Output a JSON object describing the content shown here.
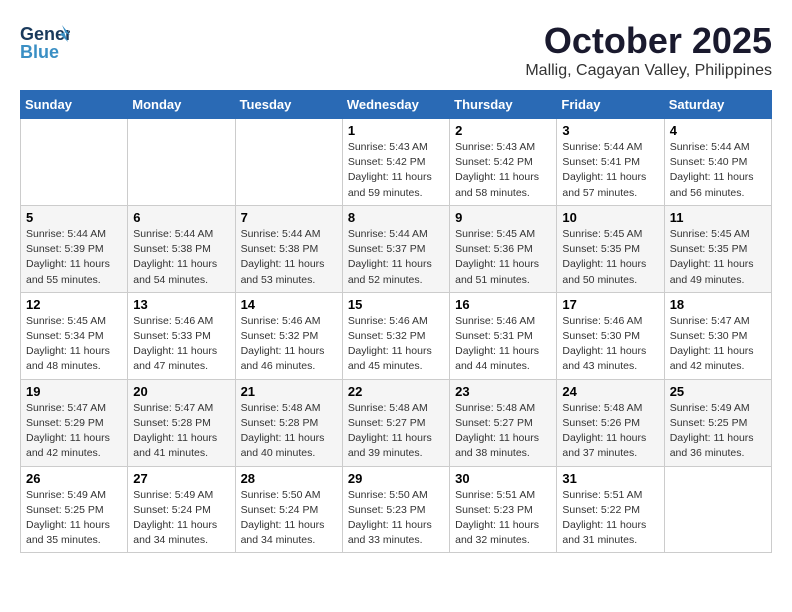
{
  "header": {
    "logo": {
      "general": "General",
      "blue": "Blue",
      "icon": "🔵"
    },
    "title": "October 2025",
    "subtitle": "Mallig, Cagayan Valley, Philippines"
  },
  "weekdays": [
    "Sunday",
    "Monday",
    "Tuesday",
    "Wednesday",
    "Thursday",
    "Friday",
    "Saturday"
  ],
  "weeks": [
    [
      {
        "day": "",
        "sunrise": "",
        "sunset": "",
        "daylight": ""
      },
      {
        "day": "",
        "sunrise": "",
        "sunset": "",
        "daylight": ""
      },
      {
        "day": "",
        "sunrise": "",
        "sunset": "",
        "daylight": ""
      },
      {
        "day": "1",
        "sunrise": "Sunrise: 5:43 AM",
        "sunset": "Sunset: 5:42 PM",
        "daylight": "Daylight: 11 hours and 59 minutes."
      },
      {
        "day": "2",
        "sunrise": "Sunrise: 5:43 AM",
        "sunset": "Sunset: 5:42 PM",
        "daylight": "Daylight: 11 hours and 58 minutes."
      },
      {
        "day": "3",
        "sunrise": "Sunrise: 5:44 AM",
        "sunset": "Sunset: 5:41 PM",
        "daylight": "Daylight: 11 hours and 57 minutes."
      },
      {
        "day": "4",
        "sunrise": "Sunrise: 5:44 AM",
        "sunset": "Sunset: 5:40 PM",
        "daylight": "Daylight: 11 hours and 56 minutes."
      }
    ],
    [
      {
        "day": "5",
        "sunrise": "Sunrise: 5:44 AM",
        "sunset": "Sunset: 5:39 PM",
        "daylight": "Daylight: 11 hours and 55 minutes."
      },
      {
        "day": "6",
        "sunrise": "Sunrise: 5:44 AM",
        "sunset": "Sunset: 5:38 PM",
        "daylight": "Daylight: 11 hours and 54 minutes."
      },
      {
        "day": "7",
        "sunrise": "Sunrise: 5:44 AM",
        "sunset": "Sunset: 5:38 PM",
        "daylight": "Daylight: 11 hours and 53 minutes."
      },
      {
        "day": "8",
        "sunrise": "Sunrise: 5:44 AM",
        "sunset": "Sunset: 5:37 PM",
        "daylight": "Daylight: 11 hours and 52 minutes."
      },
      {
        "day": "9",
        "sunrise": "Sunrise: 5:45 AM",
        "sunset": "Sunset: 5:36 PM",
        "daylight": "Daylight: 11 hours and 51 minutes."
      },
      {
        "day": "10",
        "sunrise": "Sunrise: 5:45 AM",
        "sunset": "Sunset: 5:35 PM",
        "daylight": "Daylight: 11 hours and 50 minutes."
      },
      {
        "day": "11",
        "sunrise": "Sunrise: 5:45 AM",
        "sunset": "Sunset: 5:35 PM",
        "daylight": "Daylight: 11 hours and 49 minutes."
      }
    ],
    [
      {
        "day": "12",
        "sunrise": "Sunrise: 5:45 AM",
        "sunset": "Sunset: 5:34 PM",
        "daylight": "Daylight: 11 hours and 48 minutes."
      },
      {
        "day": "13",
        "sunrise": "Sunrise: 5:46 AM",
        "sunset": "Sunset: 5:33 PM",
        "daylight": "Daylight: 11 hours and 47 minutes."
      },
      {
        "day": "14",
        "sunrise": "Sunrise: 5:46 AM",
        "sunset": "Sunset: 5:32 PM",
        "daylight": "Daylight: 11 hours and 46 minutes."
      },
      {
        "day": "15",
        "sunrise": "Sunrise: 5:46 AM",
        "sunset": "Sunset: 5:32 PM",
        "daylight": "Daylight: 11 hours and 45 minutes."
      },
      {
        "day": "16",
        "sunrise": "Sunrise: 5:46 AM",
        "sunset": "Sunset: 5:31 PM",
        "daylight": "Daylight: 11 hours and 44 minutes."
      },
      {
        "day": "17",
        "sunrise": "Sunrise: 5:46 AM",
        "sunset": "Sunset: 5:30 PM",
        "daylight": "Daylight: 11 hours and 43 minutes."
      },
      {
        "day": "18",
        "sunrise": "Sunrise: 5:47 AM",
        "sunset": "Sunset: 5:30 PM",
        "daylight": "Daylight: 11 hours and 42 minutes."
      }
    ],
    [
      {
        "day": "19",
        "sunrise": "Sunrise: 5:47 AM",
        "sunset": "Sunset: 5:29 PM",
        "daylight": "Daylight: 11 hours and 42 minutes."
      },
      {
        "day": "20",
        "sunrise": "Sunrise: 5:47 AM",
        "sunset": "Sunset: 5:28 PM",
        "daylight": "Daylight: 11 hours and 41 minutes."
      },
      {
        "day": "21",
        "sunrise": "Sunrise: 5:48 AM",
        "sunset": "Sunset: 5:28 PM",
        "daylight": "Daylight: 11 hours and 40 minutes."
      },
      {
        "day": "22",
        "sunrise": "Sunrise: 5:48 AM",
        "sunset": "Sunset: 5:27 PM",
        "daylight": "Daylight: 11 hours and 39 minutes."
      },
      {
        "day": "23",
        "sunrise": "Sunrise: 5:48 AM",
        "sunset": "Sunset: 5:27 PM",
        "daylight": "Daylight: 11 hours and 38 minutes."
      },
      {
        "day": "24",
        "sunrise": "Sunrise: 5:48 AM",
        "sunset": "Sunset: 5:26 PM",
        "daylight": "Daylight: 11 hours and 37 minutes."
      },
      {
        "day": "25",
        "sunrise": "Sunrise: 5:49 AM",
        "sunset": "Sunset: 5:25 PM",
        "daylight": "Daylight: 11 hours and 36 minutes."
      }
    ],
    [
      {
        "day": "26",
        "sunrise": "Sunrise: 5:49 AM",
        "sunset": "Sunset: 5:25 PM",
        "daylight": "Daylight: 11 hours and 35 minutes."
      },
      {
        "day": "27",
        "sunrise": "Sunrise: 5:49 AM",
        "sunset": "Sunset: 5:24 PM",
        "daylight": "Daylight: 11 hours and 34 minutes."
      },
      {
        "day": "28",
        "sunrise": "Sunrise: 5:50 AM",
        "sunset": "Sunset: 5:24 PM",
        "daylight": "Daylight: 11 hours and 34 minutes."
      },
      {
        "day": "29",
        "sunrise": "Sunrise: 5:50 AM",
        "sunset": "Sunset: 5:23 PM",
        "daylight": "Daylight: 11 hours and 33 minutes."
      },
      {
        "day": "30",
        "sunrise": "Sunrise: 5:51 AM",
        "sunset": "Sunset: 5:23 PM",
        "daylight": "Daylight: 11 hours and 32 minutes."
      },
      {
        "day": "31",
        "sunrise": "Sunrise: 5:51 AM",
        "sunset": "Sunset: 5:22 PM",
        "daylight": "Daylight: 11 hours and 31 minutes."
      },
      {
        "day": "",
        "sunrise": "",
        "sunset": "",
        "daylight": ""
      }
    ]
  ]
}
